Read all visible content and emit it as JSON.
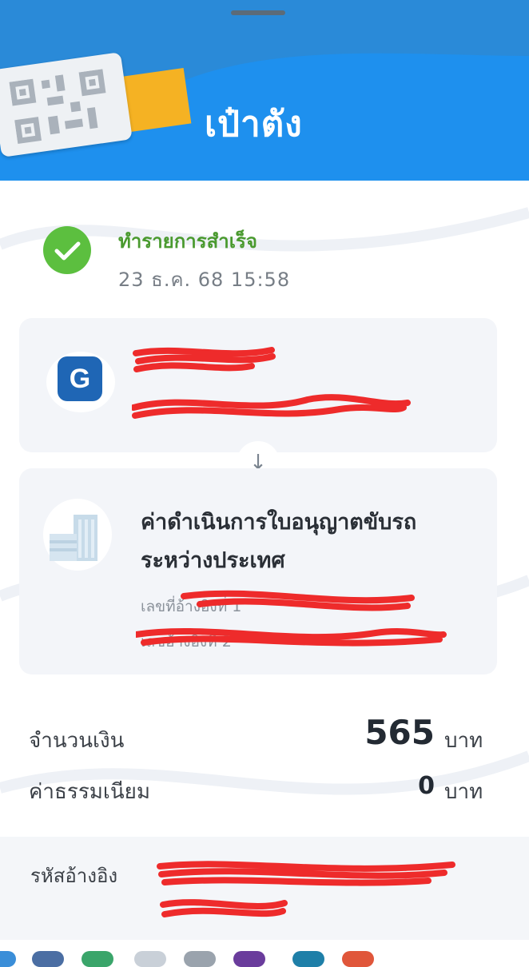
{
  "header": {
    "title": "เป๋าตัง"
  },
  "status": {
    "text": "ทำรายการสำเร็จ",
    "datetime": "23 ธ.ค. 68 15:58"
  },
  "from": {
    "logo_letter": "G"
  },
  "to": {
    "name": "ค่าดำเนินการใบอนุญาตขับรถระหว่างประเทศ",
    "ref1": "เลขที่อ้างอิงที่ 1",
    "ref2": "เลขอ้างอิงที่ 2"
  },
  "amount": {
    "label": "จำนวนเงิน",
    "value": "565",
    "unit": "บาท"
  },
  "fee": {
    "label": "ค่าธรรมเนียม",
    "value": "0",
    "unit": "บาท"
  },
  "reference": {
    "label": "รหัสอ้างอิง"
  },
  "colors": {
    "header_blue": "#1e90ee",
    "success_green": "#5cbf3f",
    "redaction_red": "#ee2b2b"
  }
}
